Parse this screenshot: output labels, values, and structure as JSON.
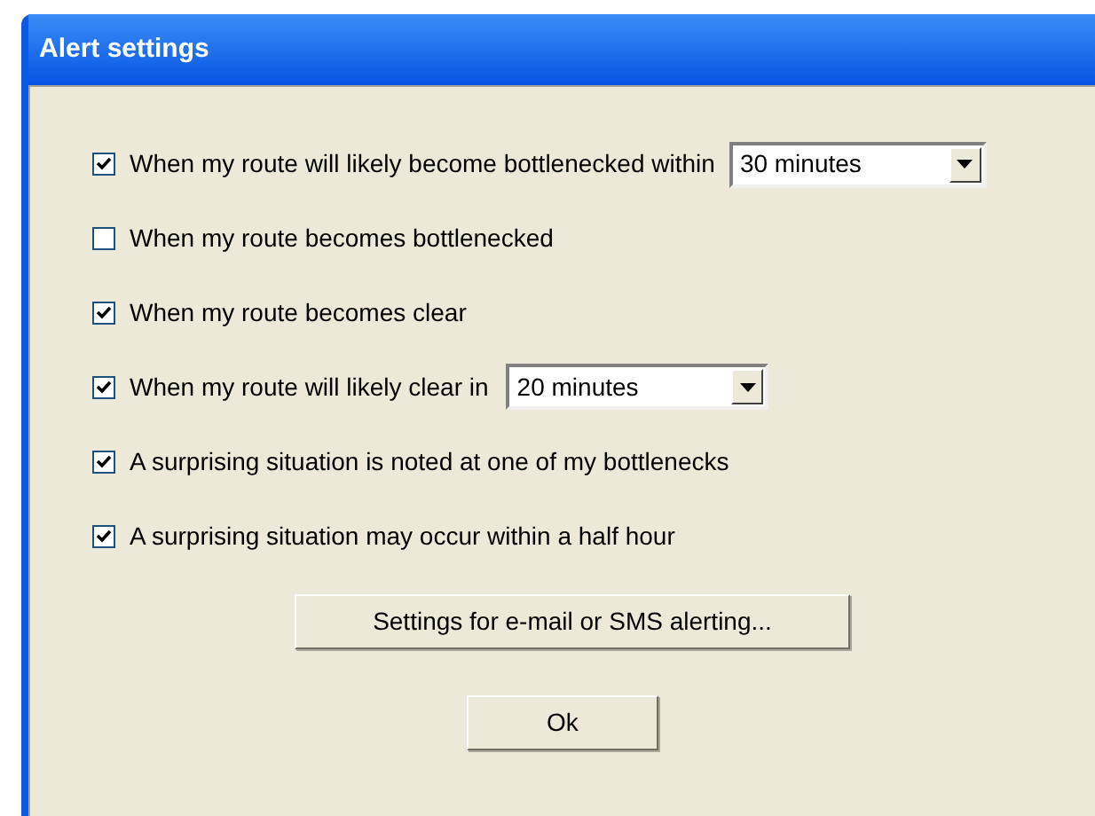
{
  "window": {
    "title": "Alert settings"
  },
  "options": [
    {
      "kind": "dropdown",
      "label": "When my route will likely become bottlenecked within",
      "checked": true,
      "value": "30 minutes"
    },
    {
      "kind": "plain",
      "label": "When my route becomes bottlenecked",
      "checked": false
    },
    {
      "kind": "plain",
      "label": "When my route becomes clear",
      "checked": true
    },
    {
      "kind": "dropdown",
      "label": "When my route will likely clear in",
      "checked": true,
      "value": "20 minutes"
    },
    {
      "kind": "plain",
      "label": "A surprising situation is noted at one of my bottlenecks",
      "checked": true
    },
    {
      "kind": "plain",
      "label": "A surprising situation may occur within a half hour",
      "checked": true
    }
  ],
  "buttons": [
    "Settings for e-mail or SMS alerting...",
    "Ok"
  ]
}
